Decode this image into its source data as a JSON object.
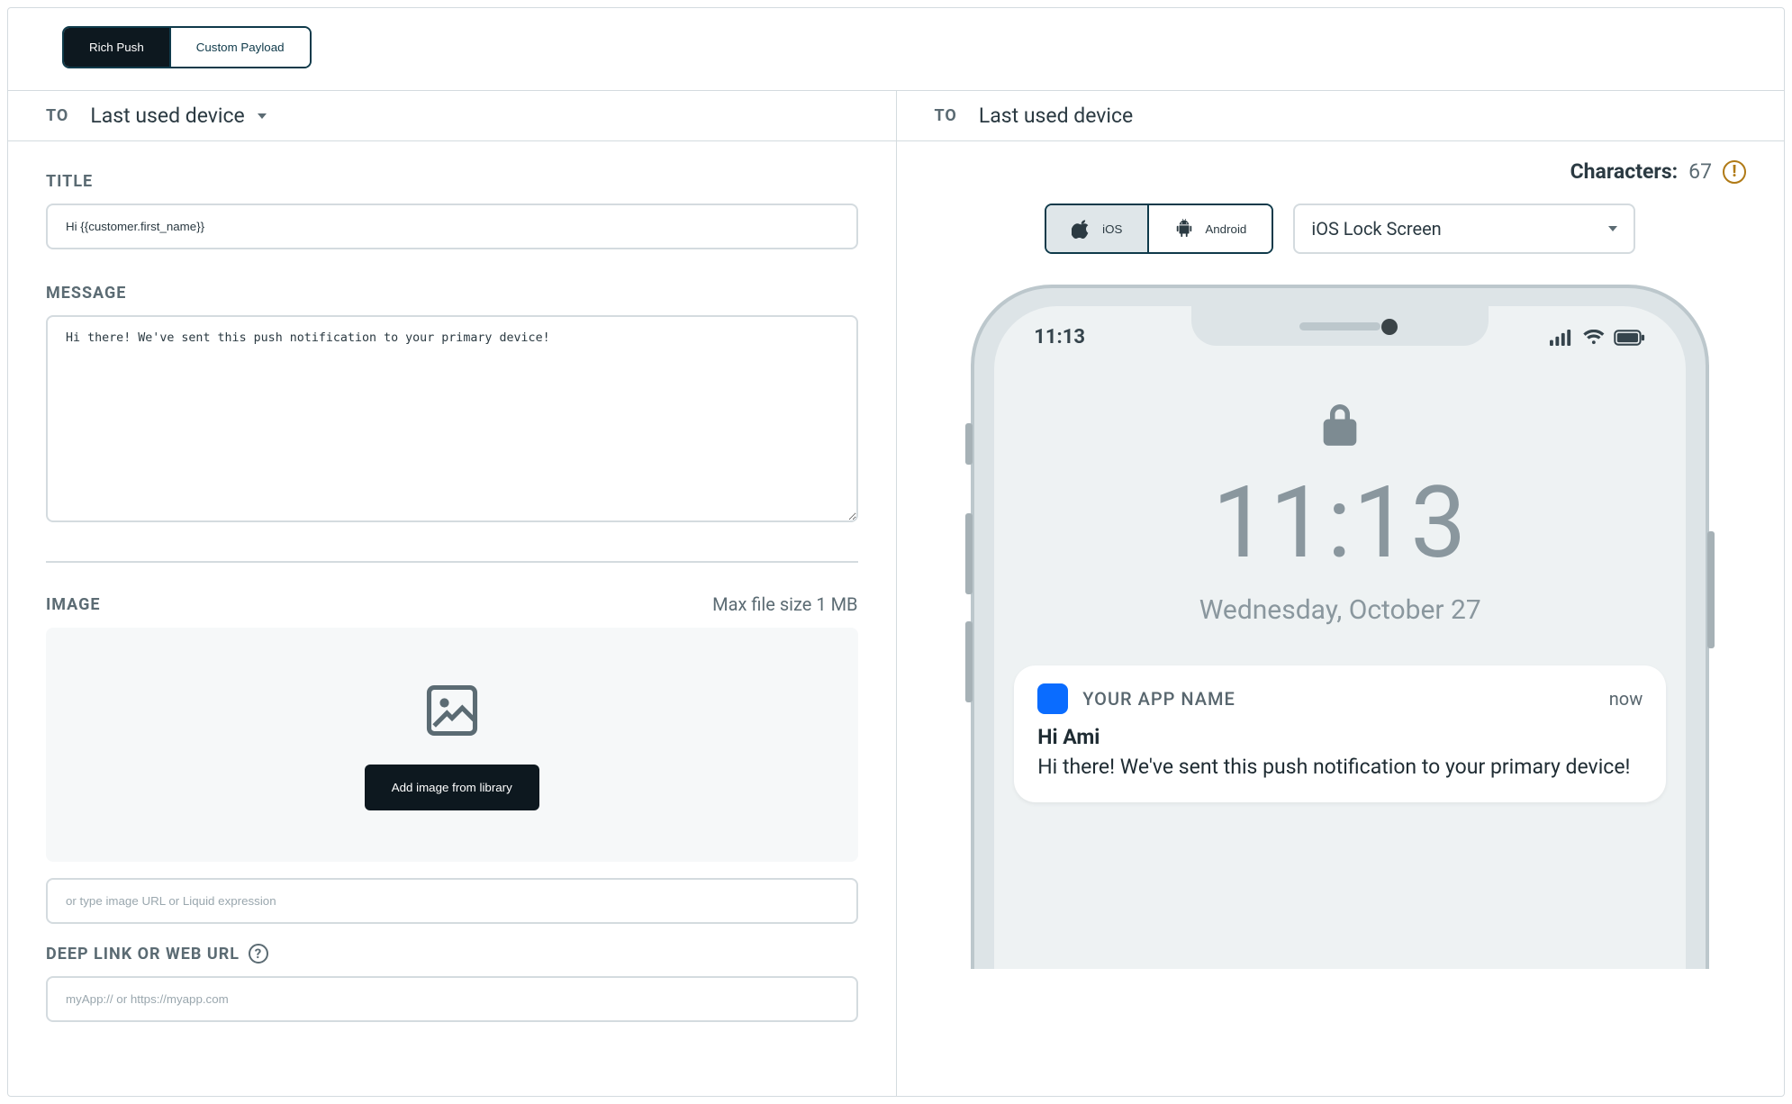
{
  "tabs": {
    "rich": "Rich Push",
    "custom": "Custom Payload"
  },
  "to": {
    "label": "TO",
    "left_value": "Last used device",
    "right_value": "Last used device"
  },
  "form": {
    "title_label": "TITLE",
    "title_value": "Hi {{customer.first_name}}",
    "message_label": "MESSAGE",
    "message_value": "Hi there! We've sent this push notification to your primary device!",
    "image_label": "IMAGE",
    "image_hint": "Max file size 1 MB",
    "add_image_btn": "Add image from library",
    "image_url_placeholder": "or type image URL or Liquid expression",
    "deeplink_label": "DEEP LINK OR WEB URL",
    "deeplink_placeholder": "myApp:// or https://myapp.com"
  },
  "preview": {
    "characters_label": "Characters",
    "characters_count": "67",
    "platform_ios": "iOS",
    "platform_android": "Android",
    "view_select": "iOS Lock Screen",
    "status_time": "11:13",
    "lock_time": "11:13",
    "lock_date": "Wednesday, October 27",
    "notif_app": "YOUR APP NAME",
    "notif_when": "now",
    "notif_title": "Hi Ami",
    "notif_message": "Hi there! We've sent this push notification to your primary device!"
  }
}
